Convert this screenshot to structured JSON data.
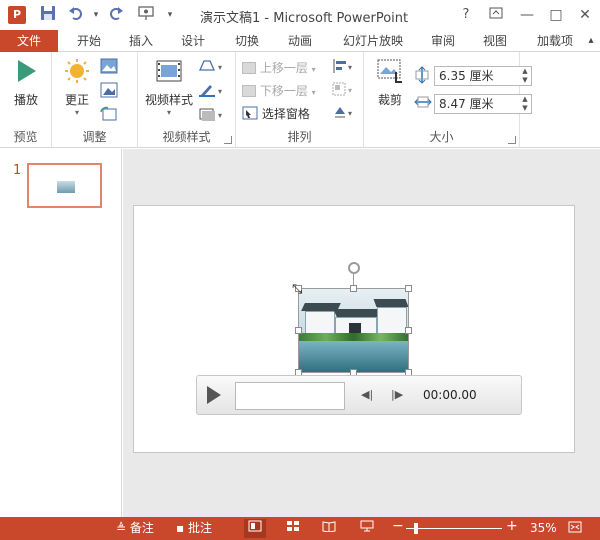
{
  "app": {
    "title": "演示文稿1 - Microsoft PowerPoint",
    "app_icon_letter": "P",
    "brand_color": "#c9472b"
  },
  "quick_access": {
    "save_icon": "save-icon",
    "undo_icon": "undo-icon",
    "redo_icon": "redo-icon",
    "present_icon": "present-from-beginning-icon"
  },
  "window_controls": {
    "help": "?",
    "restore": "restore-icon",
    "minimize": "—",
    "maximize": "□",
    "close": "✕"
  },
  "tabs": [
    "文件",
    "开始",
    "插入",
    "设计",
    "切换",
    "动画",
    "幻灯片放映",
    "审阅",
    "视图",
    "加载项"
  ],
  "ribbon": {
    "groups": {
      "preview": {
        "label": "预览",
        "play": "播放"
      },
      "adjust": {
        "label": "调整",
        "correct": "更正"
      },
      "video_styles": {
        "label": "视频样式",
        "styles": "视频样式"
      },
      "arrange": {
        "label": "排列",
        "bring_forward": "上移一层",
        "send_backward": "下移一层",
        "selection_pane": "选择窗格"
      },
      "size": {
        "label": "大小",
        "crop": "裁剪",
        "height": "6.35 厘米",
        "width": "8.47 厘米"
      }
    }
  },
  "thumbnails": [
    {
      "number": "1"
    }
  ],
  "player": {
    "time": "00:00.00"
  },
  "status": {
    "notes": "备注",
    "comments": "批注",
    "zoom": "35%"
  }
}
